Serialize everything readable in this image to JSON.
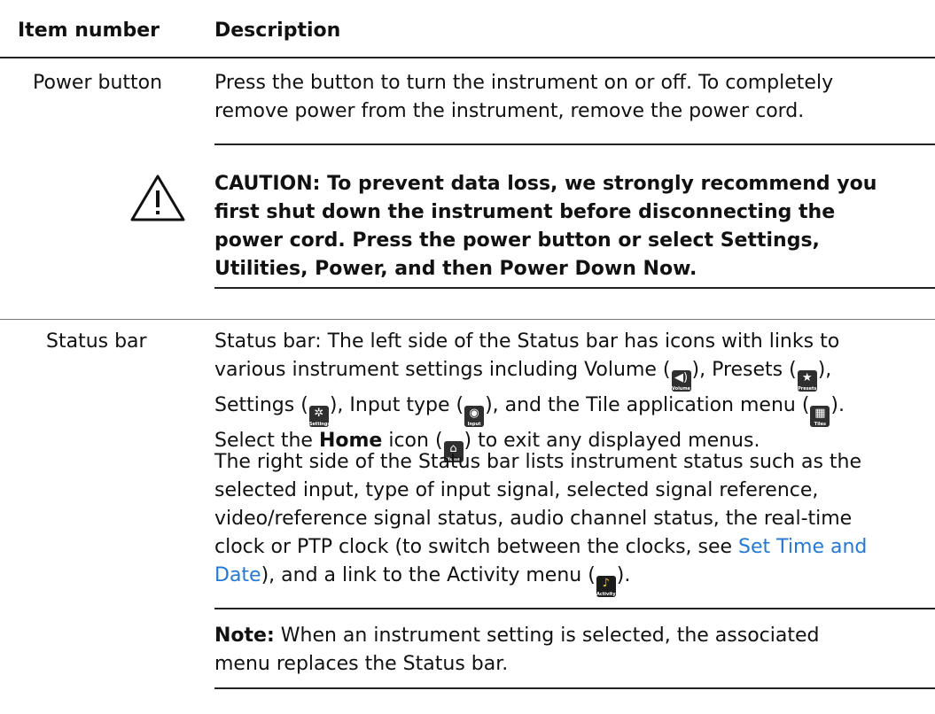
{
  "table": {
    "header": {
      "col1": "Item number",
      "col2": "Description"
    },
    "rows": [
      {
        "item": "Power button",
        "description_lines": [
          "Press the button to turn the instrument on or off. To completely",
          "remove power from the instrument, remove the power cord."
        ],
        "caution_lines": [
          "CAUTION:  To prevent data loss, we strongly recommend you",
          "first shut down the instrument before disconnecting the",
          "power cord. Press the power button or select Settings,",
          "Utilities, Power, and then Power Down Now."
        ]
      },
      {
        "item": "Status bar",
        "p1": {
          "l1": "Status bar: The left side of the Status bar has icons with links to",
          "l2a": "various instrument settings including Volume (",
          "l2b": "), Presets (",
          "l2c": "),",
          "l3a": "Settings (",
          "l3b": "), Input type (",
          "l3c": "), and the Tile application menu (",
          "l3d": ").",
          "l4a": "Select the ",
          "l4b": "Home",
          "l4c": " icon (",
          "l4d": ") to exit any displayed menus."
        },
        "p2": {
          "l1": "The right side of the Status bar lists instrument status such as the",
          "l2": "selected input, type of input signal, selected signal reference,",
          "l3": "video/reference signal status, audio channel status, the real-time",
          "l4a": "clock or PTP clock (to switch between the clocks, see ",
          "l4link": "Set Time and",
          "l5link": "Date",
          "l5a": "), and a link to the Activity menu (",
          "l5b": ")."
        },
        "note": {
          "label": "Note:",
          "l1": "  When an instrument setting is selected, the associated",
          "l2": "menu replaces the Status bar."
        }
      }
    ]
  },
  "icons": {
    "volume": {
      "glyph": "◀)",
      "caption": "Volume"
    },
    "presets": {
      "glyph": "★",
      "caption": "Presets"
    },
    "settings": {
      "glyph": "✲",
      "caption": "Settings"
    },
    "input": {
      "glyph": "◉",
      "caption": "Input"
    },
    "tiles": {
      "glyph": "▦",
      "caption": "Tiles"
    },
    "home": {
      "glyph": "⌂",
      "caption": "Home"
    },
    "activity": {
      "glyph": "♪",
      "caption": "Activity"
    }
  },
  "colors": {
    "link": "#2478d6",
    "rule": "#222222"
  }
}
